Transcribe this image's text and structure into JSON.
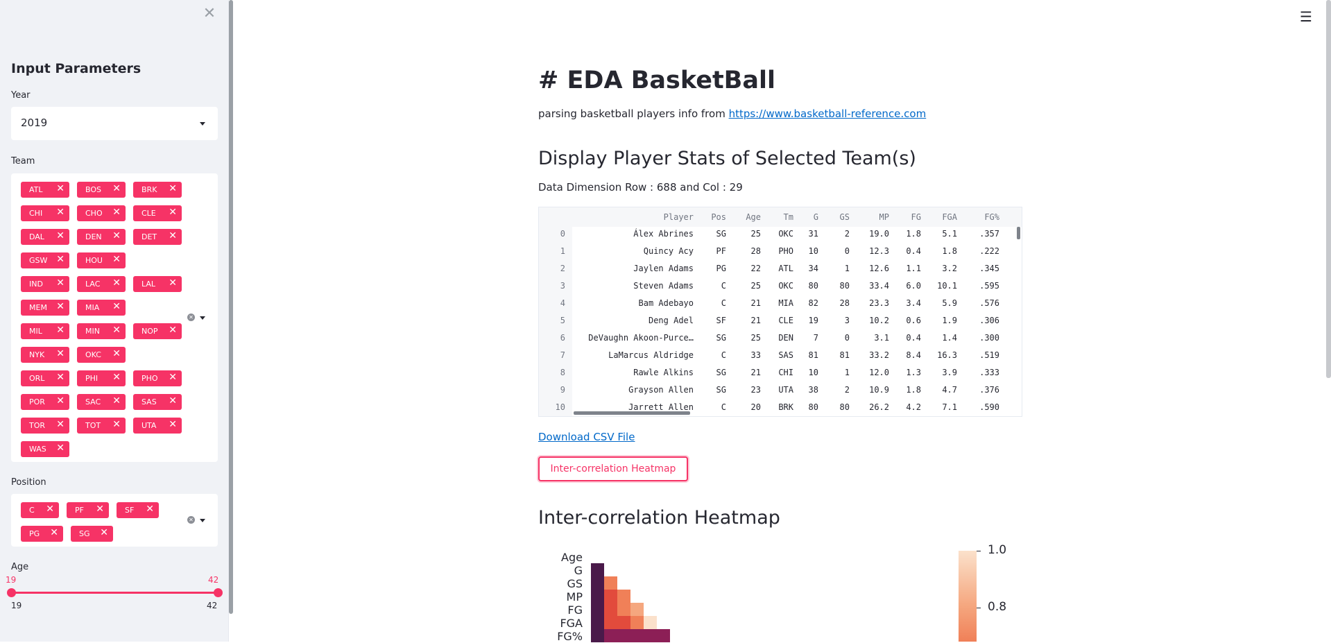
{
  "sidebar": {
    "title": "Input Parameters",
    "year_label": "Year",
    "year_value": "2019",
    "team_label": "Team",
    "teams": [
      "ATL",
      "BOS",
      "BRK",
      "CHI",
      "CHO",
      "CLE",
      "DAL",
      "DEN",
      "DET",
      "GSW",
      "HOU",
      "IND",
      "LAC",
      "LAL",
      "MEM",
      "MIA",
      "MIL",
      "MIN",
      "NOP",
      "NYK",
      "OKC",
      "ORL",
      "PHI",
      "PHO",
      "POR",
      "SAC",
      "SAS",
      "TOR",
      "TOT",
      "UTA",
      "WAS"
    ],
    "position_label": "Position",
    "positions": [
      "C",
      "PF",
      "SF",
      "PG",
      "SG"
    ],
    "age_label": "Age",
    "age_min": "19",
    "age_max": "42",
    "age_range_low": "19",
    "age_range_high": "42"
  },
  "main": {
    "title": "# EDA BasketBall",
    "desc_text": "parsing basketball players info from ",
    "desc_link": "https://www.basketball-reference.com",
    "section1": "Display Player Stats of Selected Team(s)",
    "dimension": "Data Dimension Row : 688 and Col : 29",
    "download_link": "Download CSV File",
    "heatmap_button": "Inter-correlation Heatmap",
    "section2": "Inter-correlation Heatmap"
  },
  "table": {
    "columns": [
      "Player",
      "Pos",
      "Age",
      "Tm",
      "G",
      "GS",
      "MP",
      "FG",
      "FGA",
      "FG%"
    ],
    "rows": [
      [
        "0",
        "Álex Abrines",
        "SG",
        "25",
        "OKC",
        "31",
        "2",
        "19.0",
        "1.8",
        "5.1",
        ".357"
      ],
      [
        "1",
        "Quincy Acy",
        "PF",
        "28",
        "PHO",
        "10",
        "0",
        "12.3",
        "0.4",
        "1.8",
        ".222"
      ],
      [
        "2",
        "Jaylen Adams",
        "PG",
        "22",
        "ATL",
        "34",
        "1",
        "12.6",
        "1.1",
        "3.2",
        ".345"
      ],
      [
        "3",
        "Steven Adams",
        "C",
        "25",
        "OKC",
        "80",
        "80",
        "33.4",
        "6.0",
        "10.1",
        ".595"
      ],
      [
        "4",
        "Bam Adebayo",
        "C",
        "21",
        "MIA",
        "82",
        "28",
        "23.3",
        "3.4",
        "5.9",
        ".576"
      ],
      [
        "5",
        "Deng Adel",
        "SF",
        "21",
        "CLE",
        "19",
        "3",
        "10.2",
        "0.6",
        "1.9",
        ".306"
      ],
      [
        "6",
        "DeVaughn Akoon-Purce…",
        "SG",
        "25",
        "DEN",
        "7",
        "0",
        "3.1",
        "0.4",
        "1.4",
        ".300"
      ],
      [
        "7",
        "LaMarcus Aldridge",
        "C",
        "33",
        "SAS",
        "81",
        "81",
        "33.2",
        "8.4",
        "16.3",
        ".519"
      ],
      [
        "8",
        "Rawle Alkins",
        "SG",
        "21",
        "CHI",
        "10",
        "1",
        "12.0",
        "1.3",
        "3.9",
        ".333"
      ],
      [
        "9",
        "Grayson Allen",
        "SG",
        "23",
        "UTA",
        "38",
        "2",
        "10.9",
        "1.8",
        "4.7",
        ".376"
      ],
      [
        "10",
        "Jarrett Allen",
        "C",
        "20",
        "BRK",
        "80",
        "80",
        "26.2",
        "4.2",
        "7.1",
        ".590"
      ]
    ]
  },
  "heatmap": {
    "row_labels": [
      "Age",
      "G",
      "GS",
      "MP",
      "FG",
      "FGA",
      "FG%"
    ],
    "colorbar_ticks": [
      "1.0",
      "0.8"
    ],
    "colors": {
      "dark": "#4a1a4a",
      "mid_dark": "#8c1f56",
      "red": "#e24b3c",
      "orange": "#f08058",
      "peach": "#f5a77f",
      "light": "#fbe1cb"
    }
  },
  "colors": {
    "accent": "#f63366",
    "link": "#0068c9",
    "sidebar_bg": "#f0f2f6"
  }
}
